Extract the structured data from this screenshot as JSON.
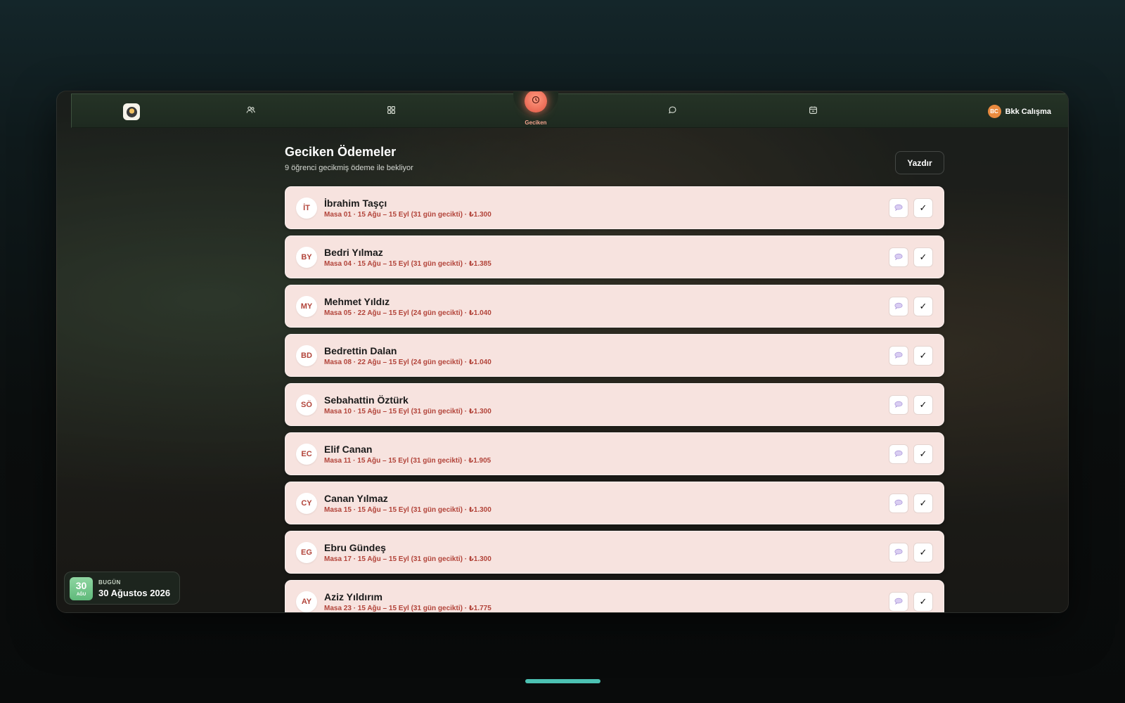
{
  "nav": {
    "items": [
      {
        "icon": "app-logo"
      },
      {
        "icon": "users-icon"
      },
      {
        "icon": "grid-icon"
      },
      {
        "icon": "clock-icon",
        "label": "Geciken",
        "active": true
      },
      {
        "icon": "chat-icon"
      },
      {
        "icon": "calendar-icon"
      }
    ],
    "active_label": "Geciken",
    "user": {
      "initials": "BC",
      "name": "Bkk Calışma"
    }
  },
  "page": {
    "title": "Geciken Ödemeler",
    "subtitle": "9 öğrenci gecikmiş ödeme ile bekliyor",
    "print_label": "Yazdır"
  },
  "late_payments": [
    {
      "initials": "İT",
      "name": "İbrahim Taşçı",
      "detail": "Masa 01 · 15 Ağu – 15 Eyl (31 gün gecikti) · ₺1.300"
    },
    {
      "initials": "BY",
      "name": "Bedri Yılmaz",
      "detail": "Masa 04 · 15 Ağu – 15 Eyl (31 gün gecikti) · ₺1.385"
    },
    {
      "initials": "MY",
      "name": "Mehmet Yıldız",
      "detail": "Masa 05 · 22 Ağu – 15 Eyl (24 gün gecikti) · ₺1.040"
    },
    {
      "initials": "BD",
      "name": "Bedrettin Dalan",
      "detail": "Masa 08 · 22 Ağu – 15 Eyl (24 gün gecikti) · ₺1.040"
    },
    {
      "initials": "SÖ",
      "name": "Sebahattin Öztürk",
      "detail": "Masa 10 · 15 Ağu – 15 Eyl (31 gün gecikti) · ₺1.300"
    },
    {
      "initials": "EC",
      "name": "Elif Canan",
      "detail": "Masa 11 · 15 Ağu – 15 Eyl (31 gün gecikti) · ₺1.905"
    },
    {
      "initials": "CY",
      "name": "Canan Yılmaz",
      "detail": "Masa 15 · 15 Ağu – 15 Eyl (31 gün gecikti) · ₺1.300"
    },
    {
      "initials": "EG",
      "name": "Ebru Gündeş",
      "detail": "Masa 17 · 15 Ağu – 15 Eyl (31 gün gecikti) · ₺1.300"
    },
    {
      "initials": "AY",
      "name": "Aziz Yıldırım",
      "detail": "Masa 23 · 15 Ağu – 15 Eyl (31 gün gecikti) · ₺1.775"
    }
  ],
  "row_actions": {
    "message_icon": "speech-bubble-icon",
    "check_glyph": "✓"
  },
  "date_widget": {
    "day": "30",
    "month_short": "AĞU",
    "label": "BUGÜN",
    "full_date": "30 Ağustos 2026"
  },
  "colors": {
    "accent": "#ea6a55",
    "row_bg": "#f7e3df",
    "detail_text": "#b2443a",
    "date_badge": "#6fc488",
    "home_indicator": "#4cc2b3"
  }
}
